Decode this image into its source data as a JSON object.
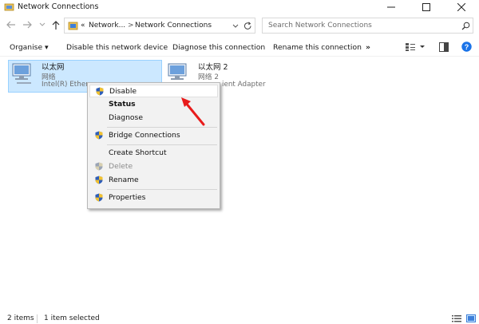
{
  "window": {
    "title": "Network Connections",
    "min_icon": "minimize-icon",
    "max_icon": "maximize-icon",
    "close_icon": "close-icon"
  },
  "address_bar": {
    "prefix": "«",
    "crumb1": "Network...",
    "separator": ">",
    "crumb2": "Network Connections",
    "search_placeholder": "Search Network Connections"
  },
  "toolbar": {
    "organise": "Organise ▾",
    "disable": "Disable this network device",
    "diagnose": "Diagnose this connection",
    "rename": "Rename this connection",
    "more": "»"
  },
  "items": [
    {
      "name": "以太网",
      "status": "网络",
      "adapter": "Intel(R) Ethern"
    },
    {
      "name": "以太网 2",
      "status": "网络 2",
      "adapter": "ient Adapter"
    }
  ],
  "context_menu": {
    "items": [
      {
        "label": "Disable",
        "shield": true
      },
      {
        "label": "Status",
        "bold": true
      },
      {
        "label": "Diagnose"
      },
      {
        "label": "Bridge Connections",
        "shield": true
      },
      {
        "label": "Create Shortcut"
      },
      {
        "label": "Delete",
        "shield": true,
        "disabled": true
      },
      {
        "label": "Rename",
        "shield": true
      },
      {
        "label": "Properties",
        "shield": true
      }
    ]
  },
  "status_bar": {
    "count": "2 items",
    "selected": "1 item selected"
  },
  "colors": {
    "selection_bg": "#cce8ff",
    "annotation_arrow": "#e81c1c",
    "help_blue": "#1a73e8"
  }
}
